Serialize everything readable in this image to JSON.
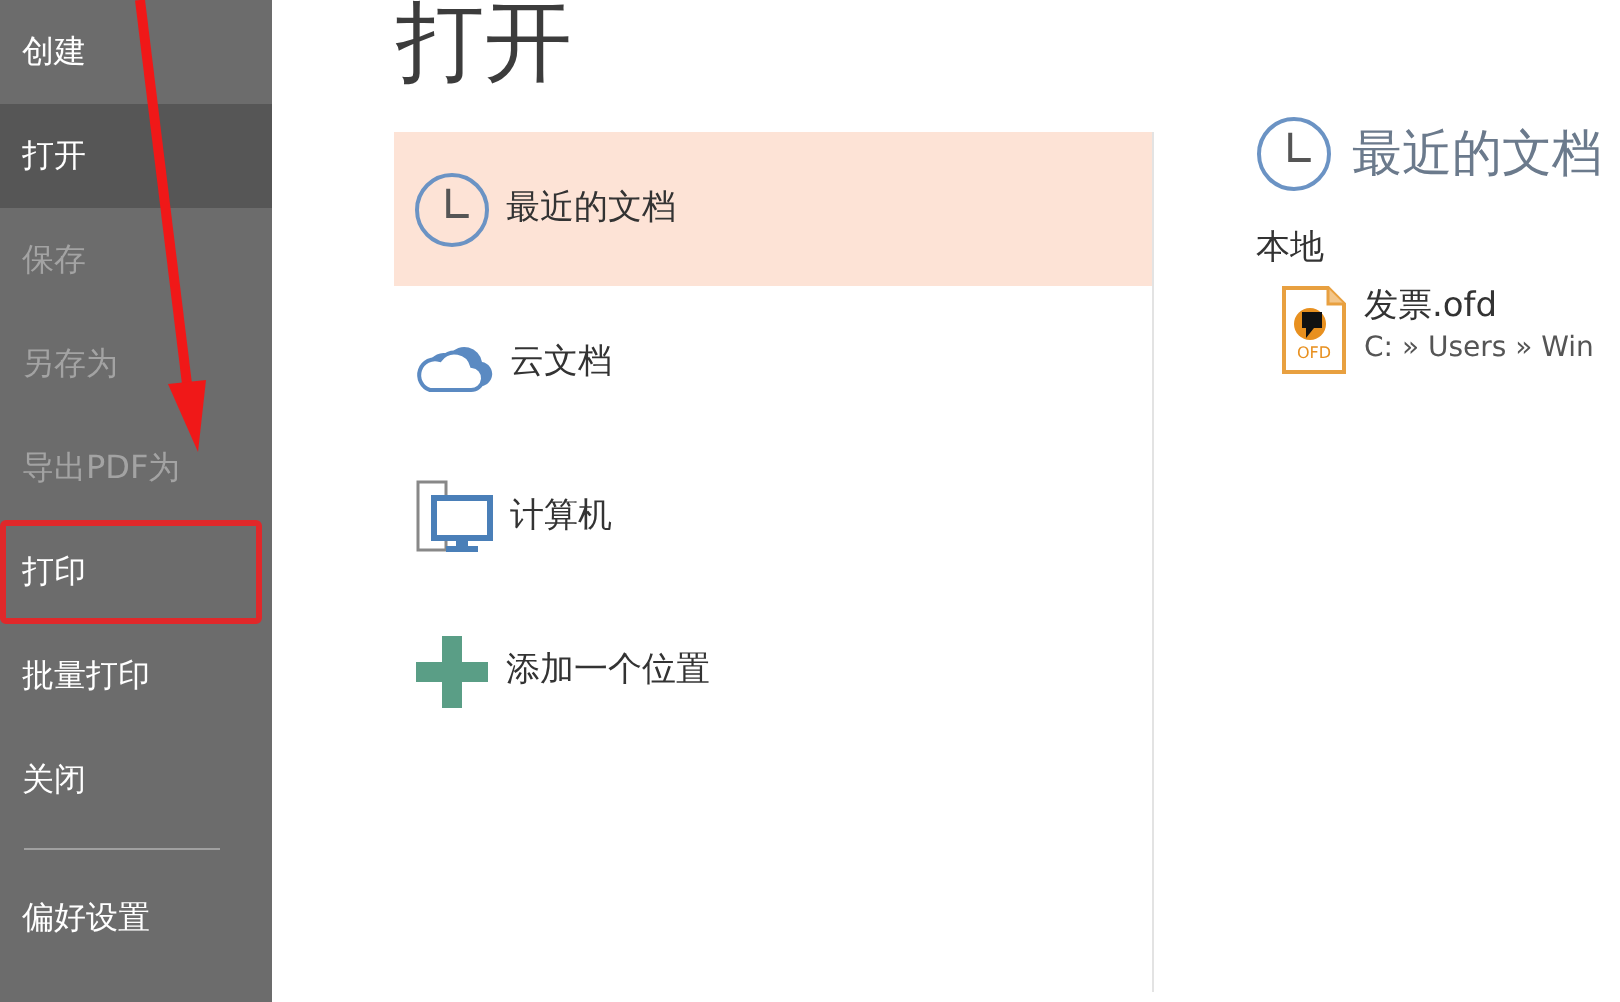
{
  "sidebar": {
    "items": [
      {
        "label": "创建",
        "selected": false,
        "disabled": false,
        "highlighted": false
      },
      {
        "label": "打开",
        "selected": true,
        "disabled": false,
        "highlighted": false
      },
      {
        "label": "保存",
        "selected": false,
        "disabled": true,
        "highlighted": false
      },
      {
        "label": "另存为",
        "selected": false,
        "disabled": true,
        "highlighted": false
      },
      {
        "label": "导出PDF为",
        "selected": false,
        "disabled": true,
        "highlighted": false
      },
      {
        "label": "打印",
        "selected": false,
        "disabled": false,
        "highlighted": true
      },
      {
        "label": "批量打印",
        "selected": false,
        "disabled": false,
        "highlighted": false
      },
      {
        "label": "关闭",
        "selected": false,
        "disabled": false,
        "highlighted": false,
        "divider_after": true
      },
      {
        "label": "偏好设置",
        "selected": false,
        "disabled": false,
        "highlighted": false
      }
    ]
  },
  "title": "打开",
  "locations": [
    {
      "kind": "recent",
      "label": "最近的文档",
      "selected": true
    },
    {
      "kind": "cloud",
      "label": "云文档",
      "selected": false
    },
    {
      "kind": "computer",
      "label": "计算机",
      "selected": false
    },
    {
      "kind": "add",
      "label": "添加一个位置",
      "selected": false
    }
  ],
  "recent_panel": {
    "heading": "最近的文档",
    "group": "本地",
    "files": [
      {
        "name": "发票.ofd",
        "path": "C: » Users » Win",
        "icon_text": "OFD"
      }
    ]
  }
}
